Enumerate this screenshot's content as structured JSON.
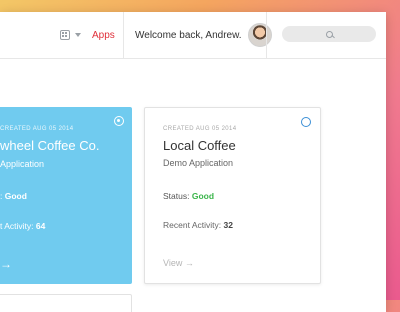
{
  "header": {
    "apps_label": "Apps",
    "welcome_text": "Welcome back, Andrew.",
    "search_placeholder": ""
  },
  "cards": [
    {
      "created": "CREATED AUG 05 2014",
      "title": "wheel Coffee Co.",
      "subtitle": "Application",
      "status_label": ": ",
      "status_value": "Good",
      "activity_label": "t Activity: ",
      "activity_value": "64",
      "arrow": "→",
      "selected": true
    },
    {
      "created": "CREATED AUG 05 2014",
      "title": "Local Coffee",
      "subtitle": "Demo Application",
      "status_label": "Status: ",
      "status_value": "Good",
      "activity_label": "Recent Activity: ",
      "activity_value": "32",
      "view_label": "View",
      "arrow": "→",
      "selected": false
    }
  ],
  "colors": {
    "accent_blue": "#70cbef",
    "status_good": "#3ab54a",
    "apps_red": "#e0303a"
  }
}
